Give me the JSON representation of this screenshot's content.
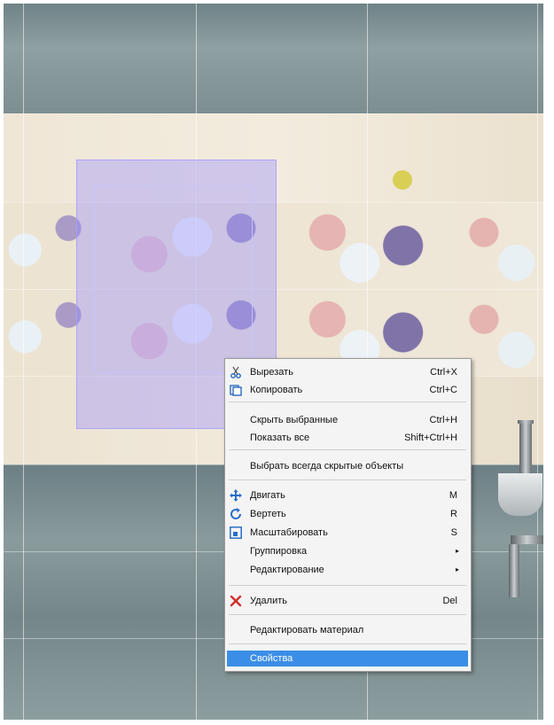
{
  "context_menu": {
    "items": [
      {
        "label": "Вырезать",
        "shortcut": "Ctrl+X",
        "icon": "scissors-icon"
      },
      {
        "label": "Копировать",
        "shortcut": "Ctrl+C",
        "icon": "copy-icon"
      },
      {
        "label": "Скрыть выбранные",
        "shortcut": "Ctrl+H"
      },
      {
        "label": "Показать все",
        "shortcut": "Shift+Ctrl+H"
      },
      {
        "label": "Выбрать всегда скрытые объекты",
        "shortcut": ""
      },
      {
        "label": "Двигать",
        "shortcut": "M",
        "icon": "move-icon"
      },
      {
        "label": "Вертеть",
        "shortcut": "R",
        "icon": "rotate-icon"
      },
      {
        "label": "Масштабировать",
        "shortcut": "S",
        "icon": "scale-icon"
      },
      {
        "label": "Группировка",
        "shortcut": "",
        "submenu": true
      },
      {
        "label": "Редактирование",
        "shortcut": "",
        "submenu": true
      },
      {
        "label": "Удалить",
        "shortcut": "Del",
        "icon": "delete-icon"
      },
      {
        "label": "Редактировать материал",
        "shortcut": ""
      },
      {
        "label": "Свойства",
        "shortcut": "",
        "highlighted": true
      }
    ],
    "submenu_arrow": "▸",
    "highlight_color": "#3b8ee6"
  },
  "scene": {
    "selection_color": "#968cff",
    "marker_color": "#d9cf55"
  }
}
